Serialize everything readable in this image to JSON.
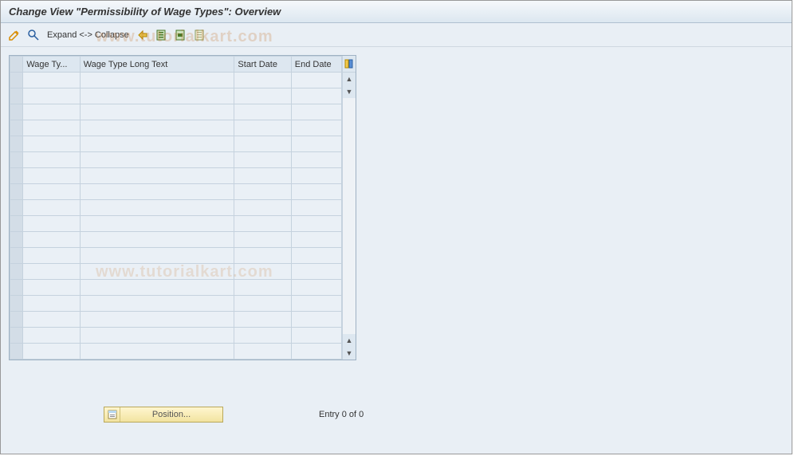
{
  "page_title": "Change View \"Permissibility of Wage Types\": Overview",
  "toolbar": {
    "glasses_icon": "glasses-icon",
    "detail_icon": "detail-icon",
    "expand_label": "Expand <-> Collapse",
    "delimit_icon": "delimit-icon",
    "select_all_icon": "select-all-icon",
    "deselect_all_icon": "deselect-all-icon",
    "select_block_icon": "select-block-icon"
  },
  "table": {
    "columns": {
      "wage_type": "Wage Ty...",
      "long_text": "Wage Type Long Text",
      "start_date": "Start Date",
      "end_date": "End Date"
    },
    "rows": [
      {
        "wage_type": "",
        "long_text": "",
        "start_date": "",
        "end_date": ""
      },
      {
        "wage_type": "",
        "long_text": "",
        "start_date": "",
        "end_date": ""
      },
      {
        "wage_type": "",
        "long_text": "",
        "start_date": "",
        "end_date": ""
      },
      {
        "wage_type": "",
        "long_text": "",
        "start_date": "",
        "end_date": ""
      },
      {
        "wage_type": "",
        "long_text": "",
        "start_date": "",
        "end_date": ""
      },
      {
        "wage_type": "",
        "long_text": "",
        "start_date": "",
        "end_date": ""
      },
      {
        "wage_type": "",
        "long_text": "",
        "start_date": "",
        "end_date": ""
      },
      {
        "wage_type": "",
        "long_text": "",
        "start_date": "",
        "end_date": ""
      },
      {
        "wage_type": "",
        "long_text": "",
        "start_date": "",
        "end_date": ""
      },
      {
        "wage_type": "",
        "long_text": "",
        "start_date": "",
        "end_date": ""
      },
      {
        "wage_type": "",
        "long_text": "",
        "start_date": "",
        "end_date": ""
      },
      {
        "wage_type": "",
        "long_text": "",
        "start_date": "",
        "end_date": ""
      },
      {
        "wage_type": "",
        "long_text": "",
        "start_date": "",
        "end_date": ""
      },
      {
        "wage_type": "",
        "long_text": "",
        "start_date": "",
        "end_date": ""
      },
      {
        "wage_type": "",
        "long_text": "",
        "start_date": "",
        "end_date": ""
      },
      {
        "wage_type": "",
        "long_text": "",
        "start_date": "",
        "end_date": ""
      },
      {
        "wage_type": "",
        "long_text": "",
        "start_date": "",
        "end_date": ""
      },
      {
        "wage_type": "",
        "long_text": "",
        "start_date": "",
        "end_date": ""
      }
    ]
  },
  "position_button": "Position...",
  "entry_text": "Entry 0 of 0",
  "watermark": "www.tutorialkart.com"
}
